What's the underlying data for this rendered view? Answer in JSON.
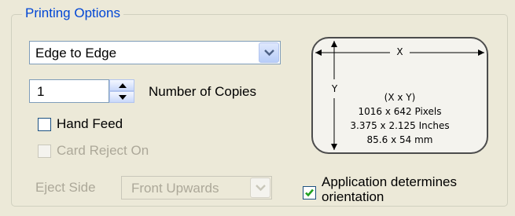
{
  "group": {
    "title": "Printing Options"
  },
  "print_mode": {
    "selected": "Edge to Edge"
  },
  "copies": {
    "value": "1",
    "label": "Number of Copies"
  },
  "hand_feed": {
    "label": "Hand Feed",
    "checked": false
  },
  "card_reject": {
    "label": "Card Reject On",
    "checked": false,
    "enabled": false
  },
  "eject_side": {
    "label": "Eject Side",
    "selected": "Front Upwards",
    "enabled": false
  },
  "orientation": {
    "label_line1": "Application determines",
    "label_line2": "orientation",
    "checked": true
  },
  "card_preview": {
    "x_label": "X",
    "y_label": "Y",
    "formula": "(X x Y)",
    "pixels": "1016 x 642 Pixels",
    "inches": "3.375 x 2.125 Inches",
    "mm": "85.6 x 54 mm"
  },
  "colors": {
    "title": "#0046d5",
    "background": "#ece9d8",
    "disabled_text": "#aca899",
    "check": "#21a121"
  },
  "icons": [
    "chevron-down-icon",
    "spin-up-icon",
    "spin-down-icon",
    "checkmark-icon"
  ]
}
